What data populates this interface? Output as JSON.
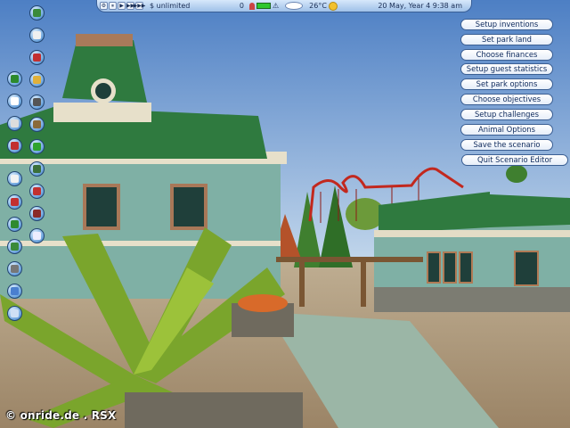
{
  "status_bar": {
    "money": "$ unlimited",
    "guests": "0",
    "temperature": "26°C",
    "date_time": "20 May, Year 4  9:38 am",
    "speed_controls": [
      "⏸",
      "▶",
      "▶▶",
      "▶▶▶"
    ]
  },
  "menu": {
    "items": [
      "Setup inventions",
      "Set park land",
      "Choose finances",
      "Setup guest statistics",
      "Set park options",
      "Choose objectives",
      "Setup challenges",
      "Animal Options",
      "Save the scenario",
      "Quit Scenario Editor"
    ]
  },
  "toolbar": {
    "icons": [
      "park-entrance-icon",
      "rides-icon",
      "shops-icon",
      "paths-icon",
      "scenery-icon",
      "terrain-icon",
      "water-icon",
      "staff-icon",
      "guests-icon",
      "research-icon",
      "finance-icon",
      "objectives-icon",
      "camera-icon",
      "options-icon",
      "map-icon",
      "fireworks-icon",
      "save-icon",
      "help-icon",
      "trash-icon",
      "zoom-icon",
      "rotate-icon",
      "info-icon",
      "sound-icon",
      "weather-icon",
      "delete-icon"
    ]
  },
  "watermark": "© onride.de . RSX",
  "colors": {
    "sky": "#7fa8d6",
    "menu_border": "#3b5f93",
    "menu_text": "#0f2a5c",
    "roof_green": "#2f7a3f",
    "wall_teal": "#7fb0a5",
    "coaster_red": "#c2281e"
  }
}
